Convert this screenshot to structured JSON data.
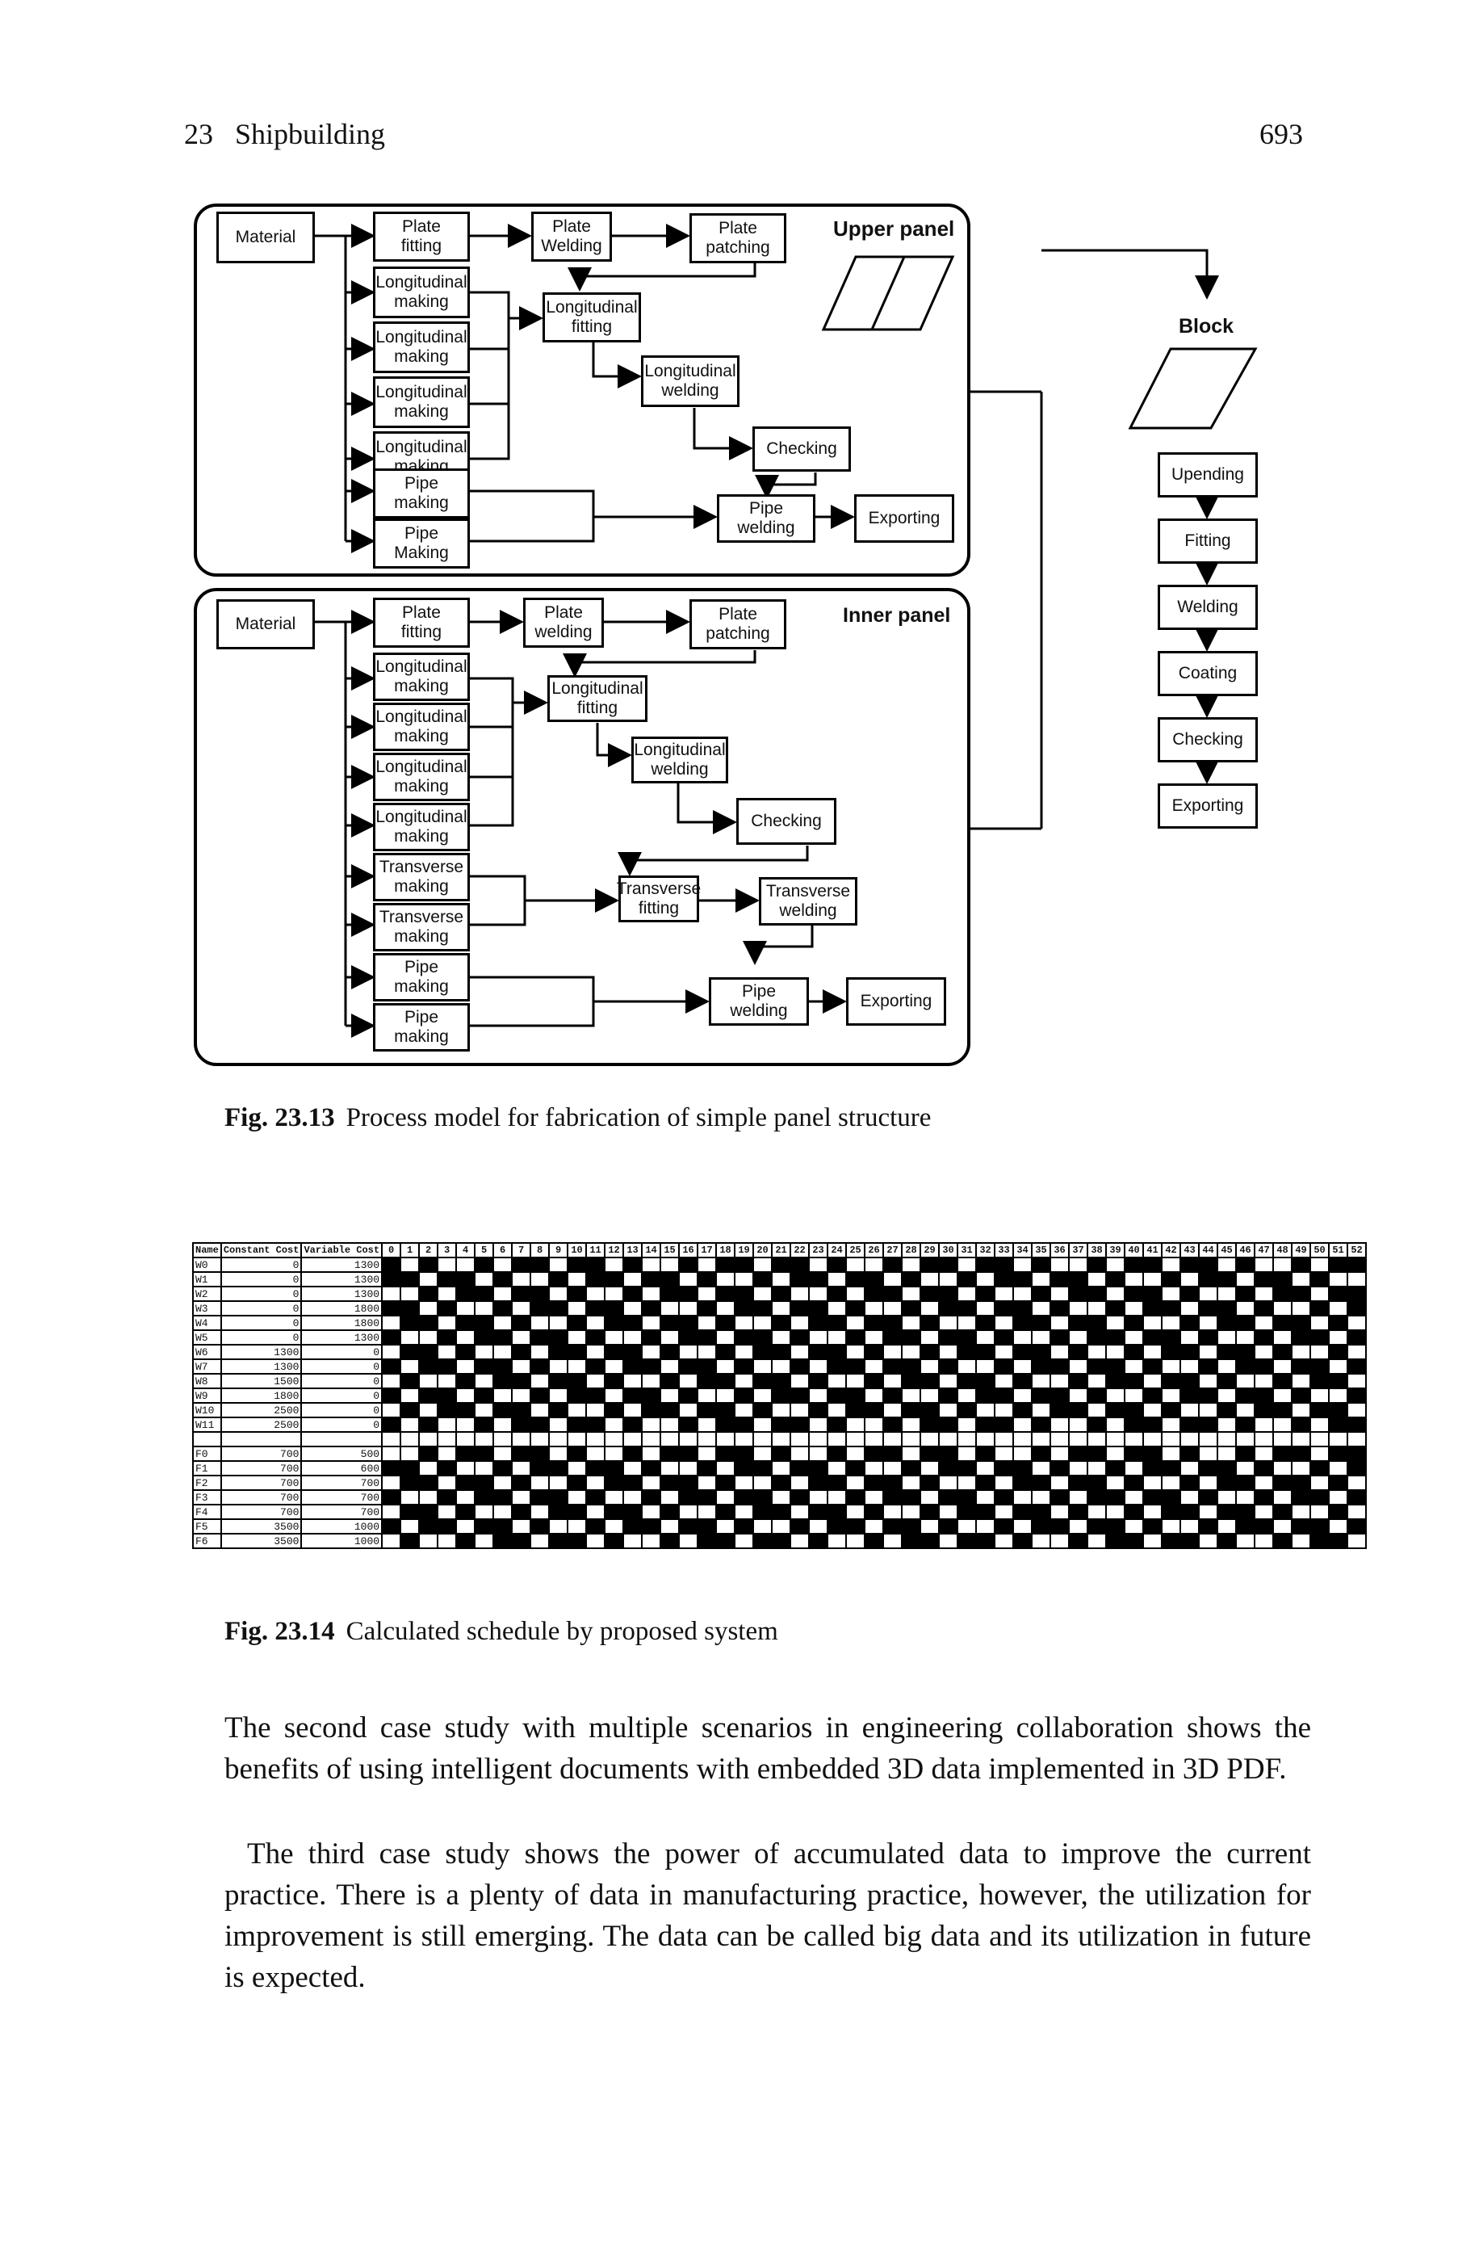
{
  "header": {
    "chapter": "23",
    "section": "Shipbuilding",
    "page": "693"
  },
  "fig13": {
    "caption_label": "Fig. 23.13",
    "caption_text": "Process model for fabrication of simple panel structure",
    "upper": {
      "title": "Upper panel",
      "material": "Material",
      "plate_fitting": "Plate\nfitting",
      "plate_welding": "Plate\nWelding",
      "plate_patching": "Plate\npatching",
      "long_making": [
        "Longitudinal\nmaking",
        "Longitudinal\nmaking",
        "Longitudinal\nmaking",
        "Longitudinal\nmaking"
      ],
      "long_fitting": "Longitudinal\nfitting",
      "long_welding": "Longitudinal\nwelding",
      "checking": "Checking",
      "pipe_making": [
        "Pipe\nmaking",
        "Pipe\nMaking"
      ],
      "pipe_welding": "Pipe\nwelding",
      "exporting": "Exporting"
    },
    "inner": {
      "title": "Inner panel",
      "material": "Material",
      "plate_fitting": "Plate\nfitting",
      "plate_welding": "Plate\nwelding",
      "plate_patching": "Plate\npatching",
      "long_making": [
        "Longitudinal\nmaking",
        "Longitudinal\nmaking",
        "Longitudinal\nmaking",
        "Longitudinal\nmaking"
      ],
      "long_fitting": "Longitudinal\nfitting",
      "long_welding": "Longitudinal\nwelding",
      "checking": "Checking",
      "trans_making": [
        "Transverse\nmaking",
        "Transverse\nmaking"
      ],
      "trans_fitting": "Transverse\nfitting",
      "trans_welding": "Transverse\nwelding",
      "pipe_making": [
        "Pipe\nmaking",
        "Pipe\nmaking"
      ],
      "pipe_welding": "Pipe\nwelding",
      "exporting": "Exporting"
    },
    "block": {
      "title": "Block",
      "steps": [
        "Upending",
        "Fitting",
        "Welding",
        "Coating",
        "Checking",
        "Exporting"
      ]
    }
  },
  "fig14": {
    "caption_label": "Fig. 23.14",
    "caption_text": "Calculated schedule by proposed system",
    "columns": [
      "Name",
      "Constant Cost",
      "Variable Cost"
    ],
    "periods_start": 0,
    "periods_end": 52,
    "rows": [
      {
        "name": "W0",
        "constant": "0",
        "variable": "1300"
      },
      {
        "name": "W1",
        "constant": "0",
        "variable": "1300"
      },
      {
        "name": "W2",
        "constant": "0",
        "variable": "1300"
      },
      {
        "name": "W3",
        "constant": "0",
        "variable": "1800"
      },
      {
        "name": "W4",
        "constant": "0",
        "variable": "1800"
      },
      {
        "name": "W5",
        "constant": "0",
        "variable": "1300"
      },
      {
        "name": "W6",
        "constant": "1300",
        "variable": "0"
      },
      {
        "name": "W7",
        "constant": "1300",
        "variable": "0"
      },
      {
        "name": "W8",
        "constant": "1500",
        "variable": "0"
      },
      {
        "name": "W9",
        "constant": "1800",
        "variable": "0"
      },
      {
        "name": "W10",
        "constant": "2500",
        "variable": "0"
      },
      {
        "name": "W11",
        "constant": "2500",
        "variable": "0"
      },
      {
        "name": "",
        "constant": "",
        "variable": ""
      },
      {
        "name": "F0",
        "constant": "700",
        "variable": "500"
      },
      {
        "name": "F1",
        "constant": "700",
        "variable": "600"
      },
      {
        "name": "F2",
        "constant": "700",
        "variable": "700"
      },
      {
        "name": "F3",
        "constant": "700",
        "variable": "700"
      },
      {
        "name": "F4",
        "constant": "700",
        "variable": "700"
      },
      {
        "name": "F5",
        "constant": "3500",
        "variable": "1000"
      },
      {
        "name": "F6",
        "constant": "3500",
        "variable": "1000"
      }
    ]
  },
  "body": {
    "p1": "The second case study with multiple scenarios in engineering collaboration shows the benefits of using intelligent documents with embedded 3D data implemented in 3D PDF.",
    "p2": "The third case study shows the power of accumulated data to improve the current practice. There is a plenty of data in manufacturing practice, however, the utilization for improvement is still emerging. The data can be called big data and its utilization in future is expected."
  }
}
